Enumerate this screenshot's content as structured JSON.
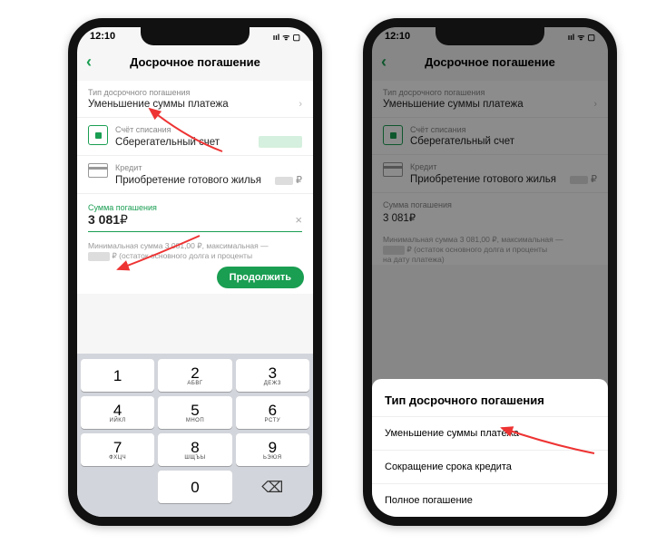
{
  "status": {
    "time": "12:10"
  },
  "header": {
    "title": "Досрочное погашение"
  },
  "type_section": {
    "label": "Тип досрочного погашения",
    "value": "Уменьшение суммы платежа"
  },
  "account_section": {
    "label": "Счёт списания",
    "value": "Сберегательный счет"
  },
  "credit_section": {
    "label": "Кредит",
    "value": "Приобретение готового жилья"
  },
  "amount_section": {
    "label": "Сумма погашения",
    "value": "3 081",
    "currency": "₽",
    "value_display": "3 081₽"
  },
  "hint": {
    "line1_prefix": "Минимальная сумма 3 081,00 ₽, максимальная —",
    "line2_suffix": "₽ (остаток основного долга и проценты",
    "line3": "на дату платежа)"
  },
  "continue_btn": "Продолжить",
  "keyboard": {
    "keys": [
      {
        "n": "1",
        "l": ""
      },
      {
        "n": "2",
        "l": "АБВГ"
      },
      {
        "n": "3",
        "l": "ДЕЖЗ"
      },
      {
        "n": "4",
        "l": "ИЙКЛ"
      },
      {
        "n": "5",
        "l": "МНОП"
      },
      {
        "n": "6",
        "l": "РСТУ"
      },
      {
        "n": "7",
        "l": "ФХЦЧ"
      },
      {
        "n": "8",
        "l": "ШЩЪЫ"
      },
      {
        "n": "9",
        "l": "ЬЭЮЯ"
      },
      {
        "n": "",
        "l": ""
      },
      {
        "n": "0",
        "l": ""
      },
      {
        "n": "⌫",
        "l": ""
      }
    ]
  },
  "ruble_sign": "₽",
  "sheet": {
    "title": "Тип досрочного погашения",
    "items": [
      "Уменьшение суммы платежа",
      "Сокращение срока кредита",
      "Полное погашение"
    ]
  }
}
